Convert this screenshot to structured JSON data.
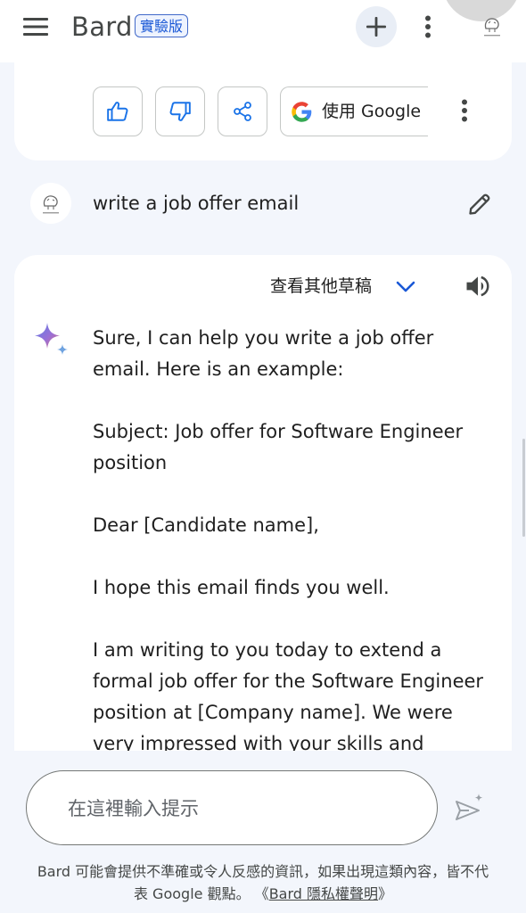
{
  "header": {
    "brand": "Bard",
    "badge": "實驗版",
    "icons": [
      "hamburger-menu-icon",
      "plus-icon",
      "vertical-dots-icon",
      "profile-avatar"
    ]
  },
  "actions": {
    "icons": [
      "thumbs-up-icon",
      "thumbs-down-icon",
      "share-icon",
      "google-g-icon",
      "vertical-dots-icon"
    ],
    "google_label": "使用 Google"
  },
  "prompt": {
    "text": "write a job offer email",
    "icons": [
      "user-avatar",
      "pencil-icon"
    ]
  },
  "response": {
    "drafts_label": "查看其他草稿",
    "icons": [
      "bard-sparkle-icon",
      "chevron-down-icon",
      "speaker-icon"
    ],
    "paragraphs": [
      "Sure, I can help you write a job offer email. Here is an example:",
      "Subject: Job offer for Software Engineer position",
      "Dear [Candidate name],",
      "I hope this email finds you well.",
      "I am writing to you today to extend a formal job offer for the Software Engineer position at [Company name]. We were very impressed with your skills and"
    ]
  },
  "input": {
    "placeholder": "在這裡輸入提示",
    "icons": [
      "send-icon"
    ]
  },
  "footer": {
    "disclaimer_line1": "Bard 可能會提供不準確或令人反感的資訊，如果出現這類內容，皆不代",
    "disclaimer_line2_pre": "表 Google 觀點。",
    "open_quote": "《",
    "privacy_link": "Bard 隱私權聲明",
    "close_quote": "》"
  },
  "colors": {
    "page_background": "#f3f6fc",
    "card_background": "#ffffff",
    "accent_blue": "#1a58d6",
    "icon_blue": "#1a73e8",
    "text": "#1f1f1f"
  }
}
